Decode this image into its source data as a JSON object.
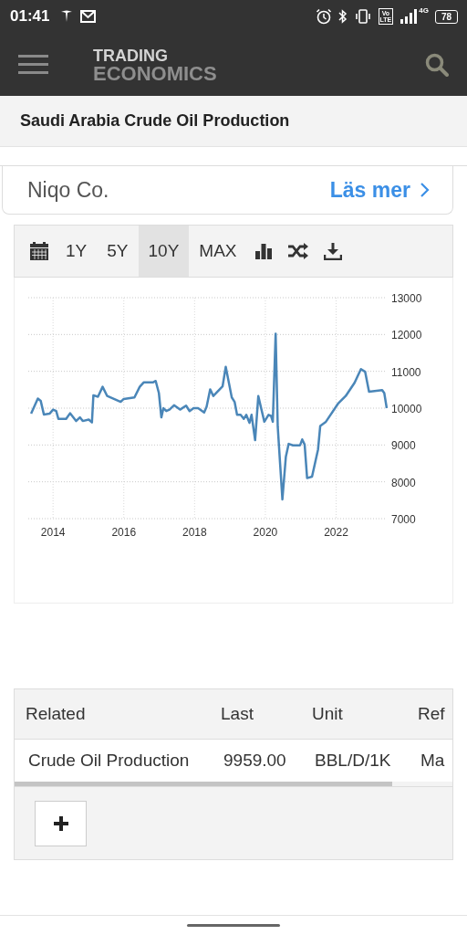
{
  "status_bar": {
    "time": "01:41",
    "volte_top": "Vo",
    "volte_bottom": "LTE",
    "network": "4G",
    "battery": "78"
  },
  "header": {
    "logo_line_1": "TRADING",
    "logo_line_2": "ECONOMICS"
  },
  "page_title": "Saudi Arabia Crude Oil Production",
  "ad": {
    "advertiser": "Niqo Co.",
    "link": "Läs mer"
  },
  "range_buttons": [
    {
      "label": "1Y",
      "selected": false
    },
    {
      "label": "5Y",
      "selected": false
    },
    {
      "label": "10Y",
      "selected": true
    },
    {
      "label": "MAX",
      "selected": false
    }
  ],
  "chart_data": {
    "type": "line",
    "xlim": [
      2013.3,
      2023.43
    ],
    "ylim": [
      7000,
      13000
    ],
    "xticks": [
      2014,
      2016,
      2018,
      2020,
      2022
    ],
    "yticks": [
      7000,
      8000,
      9000,
      10000,
      11000,
      12000,
      13000
    ],
    "x": [
      2013.38,
      2013.57,
      2013.65,
      2013.74,
      2013.9,
      2014.0,
      2014.09,
      2014.15,
      2014.37,
      2014.48,
      2014.65,
      2014.76,
      2014.84,
      2015.01,
      2015.1,
      2015.14,
      2015.27,
      2015.4,
      2015.53,
      2015.72,
      2015.91,
      2016.0,
      2016.3,
      2016.45,
      2016.56,
      2016.82,
      2016.9,
      2016.99,
      2017.06,
      2017.12,
      2017.2,
      2017.29,
      2017.42,
      2017.59,
      2017.76,
      2017.86,
      2017.97,
      2018.1,
      2018.27,
      2018.34,
      2018.44,
      2018.53,
      2018.79,
      2018.88,
      2019.05,
      2019.13,
      2019.2,
      2019.3,
      2019.39,
      2019.46,
      2019.55,
      2019.61,
      2019.71,
      2019.8,
      2019.97,
      2020.09,
      2020.16,
      2020.21,
      2020.29,
      2020.35,
      2020.48,
      2020.58,
      2020.66,
      2020.78,
      2020.98,
      2021.04,
      2021.11,
      2021.18,
      2021.32,
      2021.49,
      2021.55,
      2021.71,
      2022.05,
      2022.27,
      2022.52,
      2022.7,
      2022.82,
      2022.93,
      2023.3,
      2023.36,
      2023.43
    ],
    "grid": true,
    "series": [
      {
        "color": "#4a86b8",
        "values": [
          9850,
          10260,
          10200,
          9830,
          9850,
          9960,
          9920,
          9710,
          9710,
          9860,
          9650,
          9750,
          9650,
          9690,
          9610,
          10350,
          10310,
          10580,
          10330,
          10250,
          10170,
          10250,
          10290,
          10580,
          10700,
          10700,
          10740,
          10410,
          9750,
          10000,
          9920,
          9960,
          10080,
          9960,
          10070,
          9920,
          10000,
          10000,
          9880,
          10040,
          10510,
          10330,
          10590,
          11120,
          10290,
          10170,
          9820,
          9820,
          9710,
          9820,
          9600,
          9820,
          9130,
          10330,
          9630,
          9820,
          9790,
          9630,
          12020,
          9500,
          7520,
          8680,
          9030,
          8990,
          8990,
          9150,
          9010,
          8100,
          8140,
          8880,
          9520,
          9630,
          10120,
          10330,
          10690,
          11060,
          10990,
          10450,
          10490,
          10410,
          10000
        ]
      }
    ]
  },
  "table": {
    "columns": [
      "Related",
      "Last",
      "Unit",
      "Ref"
    ],
    "rows": [
      [
        "Crude Oil Production",
        "9959.00",
        "BBL/D/1K",
        "Ma"
      ]
    ]
  }
}
